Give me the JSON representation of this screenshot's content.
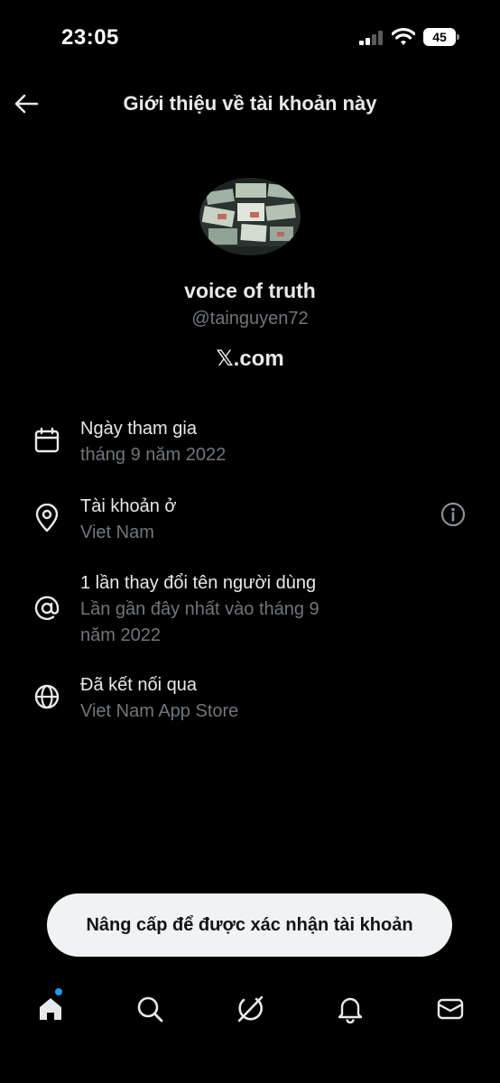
{
  "status_bar": {
    "time": "23:05",
    "battery": "45"
  },
  "header": {
    "title": "Giới thiệu về tài khoản này"
  },
  "profile": {
    "name": "voice of truth",
    "handle": "@tainguyen72",
    "site": "𝕏.com"
  },
  "info": [
    {
      "icon": "calendar-icon",
      "label": "Ngày tham gia",
      "value": "tháng 9 năm 2022"
    },
    {
      "icon": "location-pin-icon",
      "label": "Tài khoản ở",
      "value": "Viet Nam"
    },
    {
      "icon": "at-sign-icon",
      "label": "1 lần thay đổi tên người dùng",
      "value": "Lần gần đây nhất vào tháng 9 năm 2022"
    },
    {
      "icon": "globe-icon",
      "label": "Đã kết nối qua",
      "value": "Viet Nam App Store"
    }
  ],
  "upgrade_button": "Nâng cấp để được xác nhận tài khoản",
  "bottom_nav": [
    {
      "icon": "home-icon"
    },
    {
      "icon": "search-icon"
    },
    {
      "icon": "grok-icon"
    },
    {
      "icon": "bell-icon"
    },
    {
      "icon": "mail-icon"
    }
  ],
  "colors": {
    "background": "#000000",
    "primary_text": "#e7e9ea",
    "secondary_text": "#71767b",
    "accent": "#1d9bf0",
    "pill": "#eff3f4"
  }
}
